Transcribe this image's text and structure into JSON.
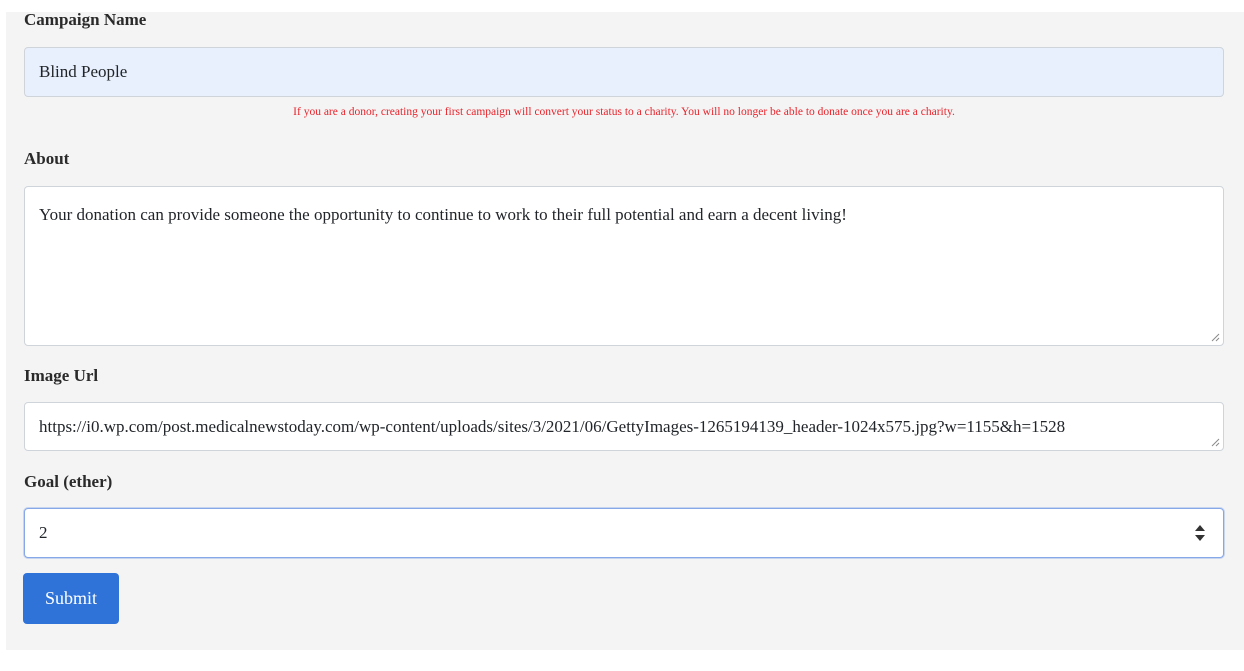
{
  "form": {
    "campaign_name": {
      "label": "Campaign Name",
      "value": "Blind People"
    },
    "warning": "If you are a donor, creating your first campaign will convert your status to a charity. You will no longer be able to donate once you are a charity.",
    "about": {
      "label": "About",
      "value": "Your donation can provide someone the opportunity to continue to work to their full potential and earn a decent living!"
    },
    "image_url": {
      "label": "Image Url",
      "value": "https://i0.wp.com/post.medicalnewstoday.com/wp-content/uploads/sites/3/2021/06/GettyImages-1265194139_header-1024x575.jpg?w=1155&h=1528"
    },
    "goal": {
      "label": "Goal (ether)",
      "value": "2"
    },
    "submit_label": "Submit"
  },
  "colors": {
    "warning": "#e8242b",
    "submit_bg": "#2f73d9",
    "autofill_bg": "#e8f0fe",
    "panel_bg": "#f4f4f5"
  },
  "icons": {
    "resize": "resize-grip-icon",
    "spinner": "number-spinner-icon"
  }
}
